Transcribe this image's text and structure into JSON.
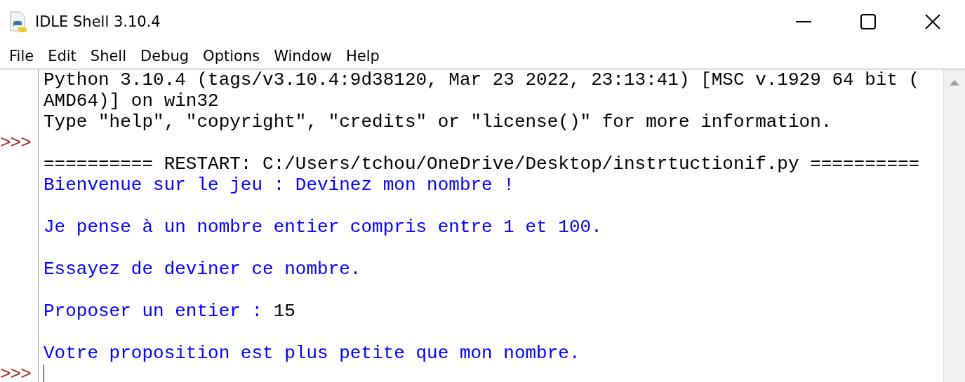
{
  "window": {
    "title": "IDLE Shell 3.10.4"
  },
  "menu": [
    "File",
    "Edit",
    "Shell",
    "Debug",
    "Options",
    "Window",
    "Help"
  ],
  "shell": {
    "lines": [
      {
        "kind": "text",
        "segments": [
          {
            "kind": "output",
            "text": "Python 3.10.4 (tags/v3.10.4:9d38120, Mar 23 2022, 23:13:41) [MSC v.1929 64 bit ("
          }
        ]
      },
      {
        "kind": "text",
        "segments": [
          {
            "kind": "output",
            "text": "AMD64)] on win32"
          }
        ]
      },
      {
        "kind": "text",
        "segments": [
          {
            "kind": "output",
            "text": "Type \"help\", \"copyright\", \"credits\" or \"license()\" for more information."
          }
        ]
      },
      {
        "kind": "prompt",
        "prompt_text": ">>>"
      },
      {
        "kind": "text",
        "segments": [
          {
            "kind": "output",
            "text": "========== RESTART: C:/Users/tchou/OneDrive/Desktop/instrtuctionif.py =========="
          }
        ]
      },
      {
        "kind": "text",
        "segments": [
          {
            "kind": "stdout",
            "text": "Bienvenue sur le jeu : Devinez mon nombre !"
          }
        ]
      },
      {
        "kind": "blank"
      },
      {
        "kind": "text",
        "segments": [
          {
            "kind": "stdout",
            "text": "Je pense à un nombre entier compris entre 1 et 100."
          }
        ]
      },
      {
        "kind": "blank"
      },
      {
        "kind": "text",
        "segments": [
          {
            "kind": "stdout",
            "text": "Essayez de deviner ce nombre."
          }
        ]
      },
      {
        "kind": "blank"
      },
      {
        "kind": "text",
        "segments": [
          {
            "kind": "stdout",
            "text": "Proposer un entier : "
          },
          {
            "kind": "input",
            "text": "15"
          }
        ]
      },
      {
        "kind": "blank"
      },
      {
        "kind": "text",
        "segments": [
          {
            "kind": "stdout",
            "text": "Votre proposition est plus petite que mon nombre."
          }
        ]
      },
      {
        "kind": "prompt",
        "prompt_text": ">>>",
        "cursor": true
      }
    ]
  }
}
